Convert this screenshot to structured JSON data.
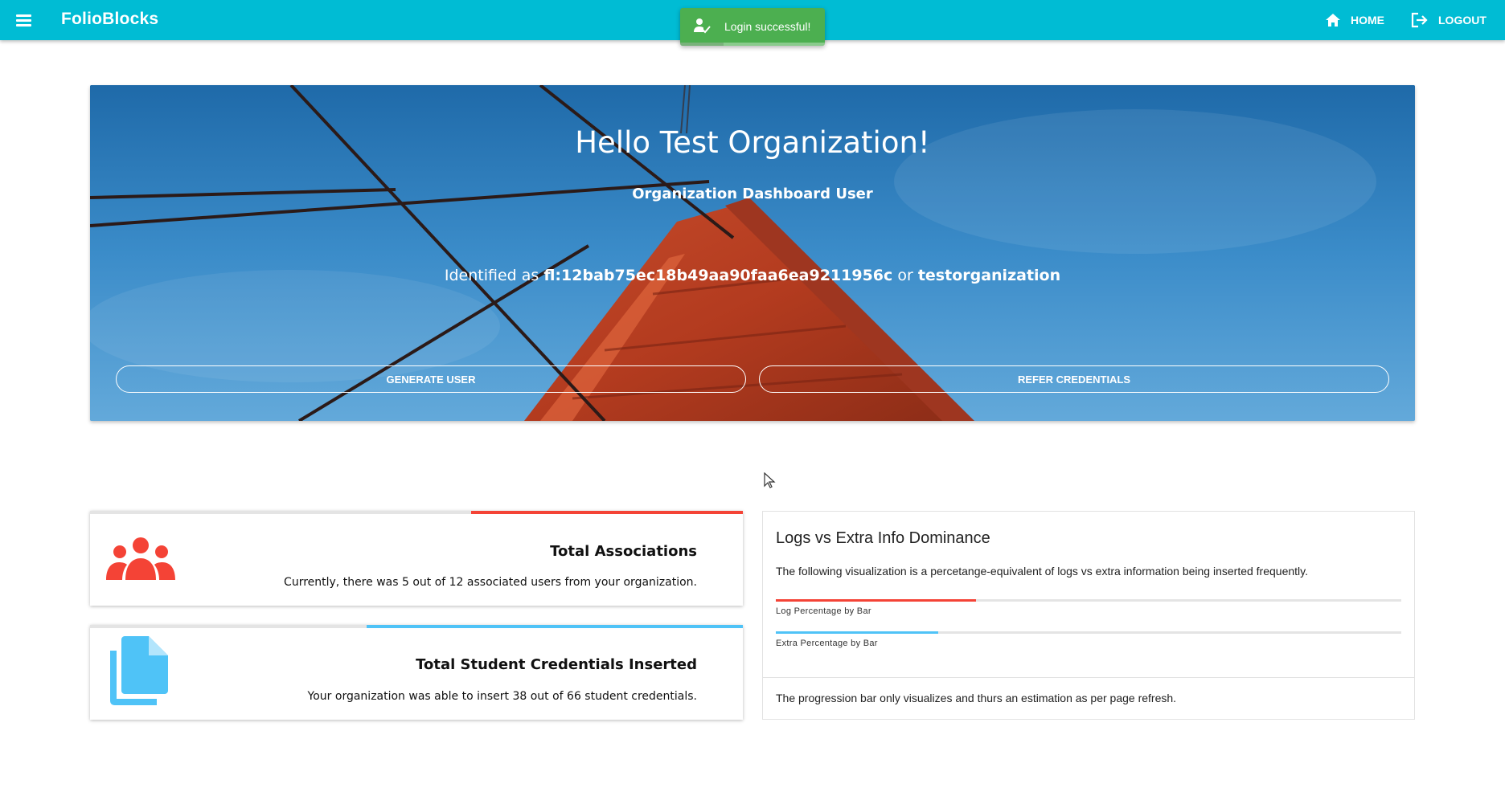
{
  "app": {
    "brand": "FolioBlocks"
  },
  "nav": {
    "home_label": "HOME",
    "logout_label": "LOGOUT"
  },
  "toast": {
    "message": "Login successful!",
    "progress": 0.3
  },
  "hero": {
    "greeting": "Hello Test Organization!",
    "role": "Organization Dashboard User",
    "identified_prefix": "Identified as",
    "identifier": "fl:12bab75ec18b49aa90faa6ea9211956c",
    "identifier_joiner": "or",
    "username": "testorganization",
    "generate_user_label": "GENERATE USER",
    "refer_credentials_label": "REFER CREDENTIALS"
  },
  "stats": [
    {
      "title": "Total Associations",
      "description": "Currently, there was 5 out of 12 associated users from your organization.",
      "progress": 0.4167,
      "color": "#f44336",
      "icon": "users-group-icon"
    },
    {
      "title": "Total Student Credentials Inserted",
      "description": "Your organization was able to insert 38 out of 66 student credentials.",
      "progress": 0.5758,
      "color": "#4fc3f7",
      "icon": "document-copy-icon"
    }
  ],
  "logs": {
    "title": "Logs vs Extra Info Dominance",
    "description": "The following visualization is a percetange-equivalent of logs vs extra information being inserted frequently.",
    "bars": [
      {
        "label": "Log Percentage by Bar",
        "value": 0.32,
        "color": "#f44336"
      },
      {
        "label": "Extra Percentage by Bar",
        "value": 0.26,
        "color": "#4fc3f7"
      }
    ],
    "footnote": "The progression bar only visualizes and thurs an estimation as per page refresh."
  }
}
